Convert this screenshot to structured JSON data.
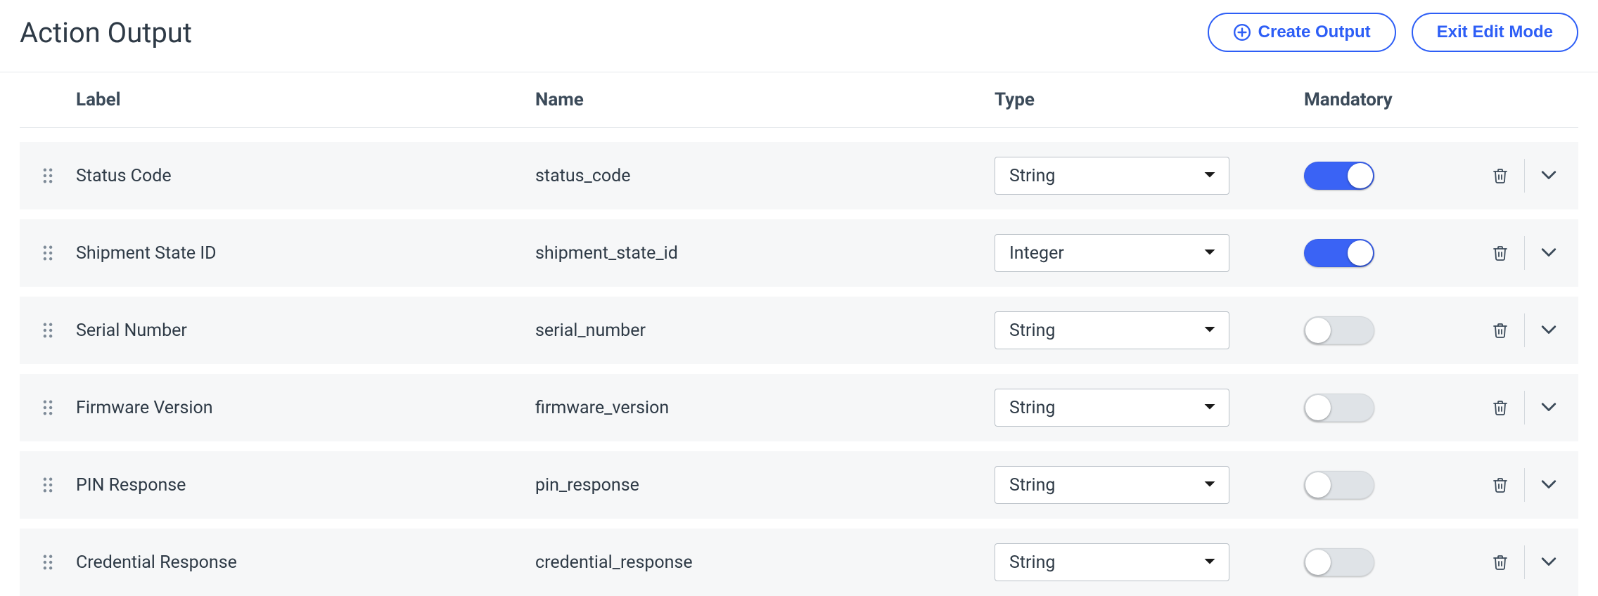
{
  "header": {
    "title": "Action Output",
    "create_label": "Create Output",
    "exit_label": "Exit Edit Mode"
  },
  "columns": {
    "label": "Label",
    "name": "Name",
    "type": "Type",
    "mandatory": "Mandatory"
  },
  "rows": [
    {
      "label": "Status Code",
      "name": "status_code",
      "type": "String",
      "mandatory": true
    },
    {
      "label": "Shipment State ID",
      "name": "shipment_state_id",
      "type": "Integer",
      "mandatory": true
    },
    {
      "label": "Serial Number",
      "name": "serial_number",
      "type": "String",
      "mandatory": false
    },
    {
      "label": "Firmware Version",
      "name": "firmware_version",
      "type": "String",
      "mandatory": false
    },
    {
      "label": "PIN Response",
      "name": "pin_response",
      "type": "String",
      "mandatory": false
    },
    {
      "label": "Credential Response",
      "name": "credential_response",
      "type": "String",
      "mandatory": false
    }
  ],
  "colors": {
    "accent": "#2d5ef6"
  }
}
